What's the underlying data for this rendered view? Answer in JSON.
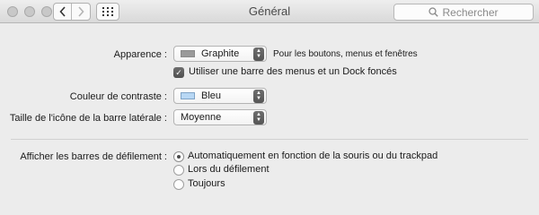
{
  "window": {
    "title": "Général",
    "search_placeholder": "Rechercher"
  },
  "settings": {
    "appearance": {
      "label": "Apparence :",
      "value": "Graphite",
      "swatch_color": "#9a9a9a",
      "note": "Pour les boutons, menus et fenêtres"
    },
    "dark_menu": {
      "label": "Utiliser une barre des menus et un Dock foncés",
      "checked": true
    },
    "highlight": {
      "label": "Couleur de contraste :",
      "value": "Bleu",
      "swatch_color": "#b7d7f4"
    },
    "sidebar_icon_size": {
      "label": "Taille de l'icône de la barre latérale :",
      "value": "Moyenne"
    },
    "scrollbars": {
      "label": "Afficher les barres de défilement :",
      "options": [
        {
          "label": "Automatiquement en fonction de la souris ou du trackpad",
          "selected": true
        },
        {
          "label": "Lors du défilement",
          "selected": false
        },
        {
          "label": "Toujours",
          "selected": false
        }
      ]
    }
  }
}
